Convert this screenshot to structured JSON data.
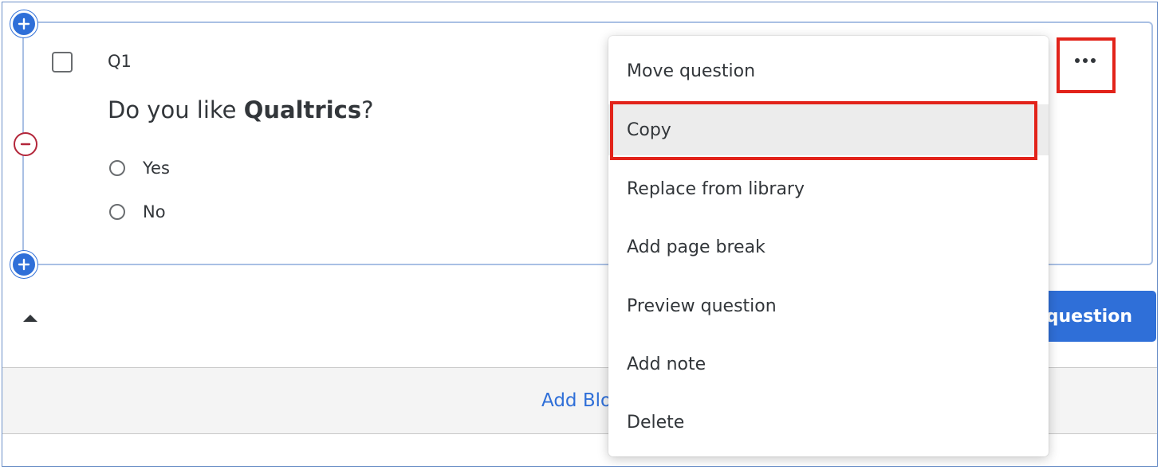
{
  "question": {
    "number": "Q1",
    "text_prefix": "Do you like ",
    "text_bold": "Qualtrics",
    "text_suffix": "?",
    "choices": [
      "Yes",
      "No"
    ]
  },
  "block": {
    "add_question_label": "question",
    "add_block_label": "Add Block"
  },
  "menu": {
    "items": [
      "Move question",
      "Copy",
      "Replace from library",
      "Add page break",
      "Preview question",
      "Add note",
      "Delete"
    ],
    "selected_index": 1
  },
  "colors": {
    "accent": "#2f6fd8",
    "highlight": "#e2231a",
    "remove": "#b3263a"
  },
  "icons": [
    "plus-icon",
    "minus-icon",
    "more-options-icon",
    "collapse-caret-icon"
  ]
}
